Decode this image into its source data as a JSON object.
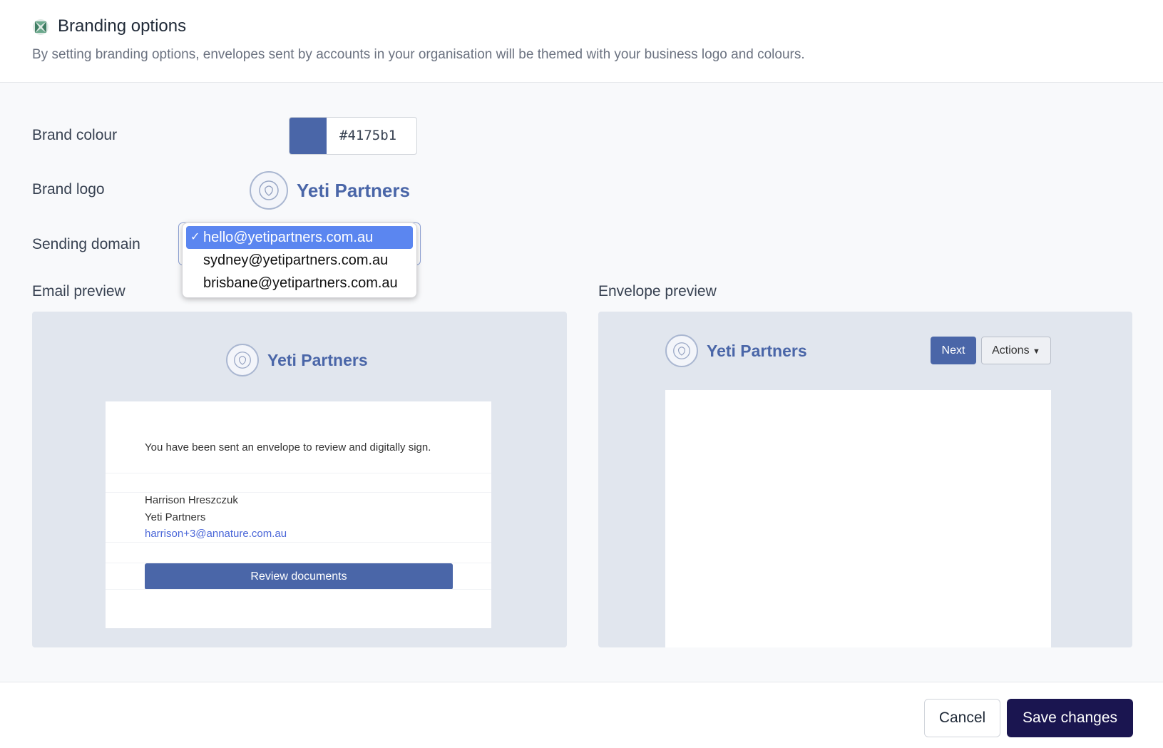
{
  "header": {
    "title": "Branding options",
    "description": "By setting branding options, envelopes sent by accounts in your organisation will be themed with your business logo and colours."
  },
  "labels": {
    "brand_colour": "Brand colour",
    "brand_logo": "Brand logo",
    "sending_domain": "Sending domain",
    "email_preview": "Email preview",
    "envelope_preview": "Envelope preview"
  },
  "brand": {
    "colour_hex": "#4175b1",
    "swatch_color": "#4a66a8",
    "logo_name": "Yeti Partners"
  },
  "sending_domain": {
    "options": [
      "hello@yetipartners.com.au",
      "sydney@yetipartners.com.au",
      "brisbane@yetipartners.com.au"
    ],
    "selected": "hello@yetipartners.com.au"
  },
  "email_preview": {
    "message": "You have been sent an envelope to review and digitally sign.",
    "sender_name": "Harrison Hreszczuk",
    "sender_company": "Yeti Partners",
    "sender_email": "harrison+3@annature.com.au",
    "button": "Review documents"
  },
  "envelope_preview": {
    "next": "Next",
    "actions": "Actions"
  },
  "footer": {
    "cancel": "Cancel",
    "save": "Save changes"
  }
}
